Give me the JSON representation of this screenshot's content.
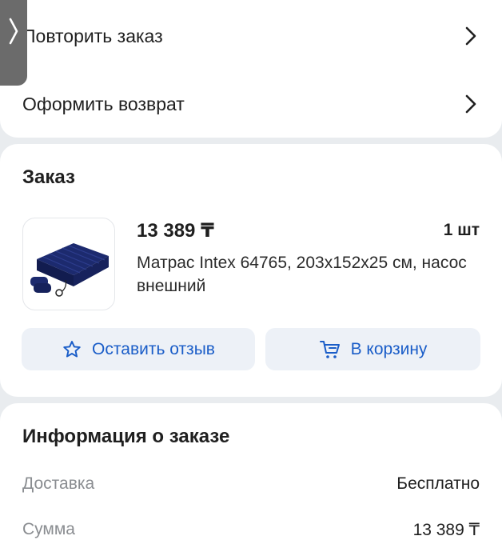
{
  "actions": {
    "repeat_order_label": "Повторить заказ",
    "return_label": "Оформить возврат"
  },
  "order": {
    "title": "Заказ",
    "item": {
      "price": "13 389 ₸",
      "quantity": "1 шт",
      "name": "Матрас Intex 64765, 203x152x25 см, насос внешний",
      "image_alt": "inflatable-mattress-image"
    },
    "review_button_label": "Оставить отзыв",
    "cart_button_label": "В корзину"
  },
  "info": {
    "title": "Информация о заказе",
    "rows": [
      {
        "key": "Доставка",
        "value": "Бесплатно"
      },
      {
        "key": "Сумма",
        "value": "13 389 ₸"
      }
    ]
  },
  "colors": {
    "accent": "#1a5dc8",
    "button_bg": "#edf1f7",
    "page_bg": "#e9ecef",
    "muted_text": "#8a8d91"
  },
  "icons": [
    "chevron-right-icon",
    "star-icon",
    "cart-icon",
    "side-handle-arrow-icon"
  ]
}
